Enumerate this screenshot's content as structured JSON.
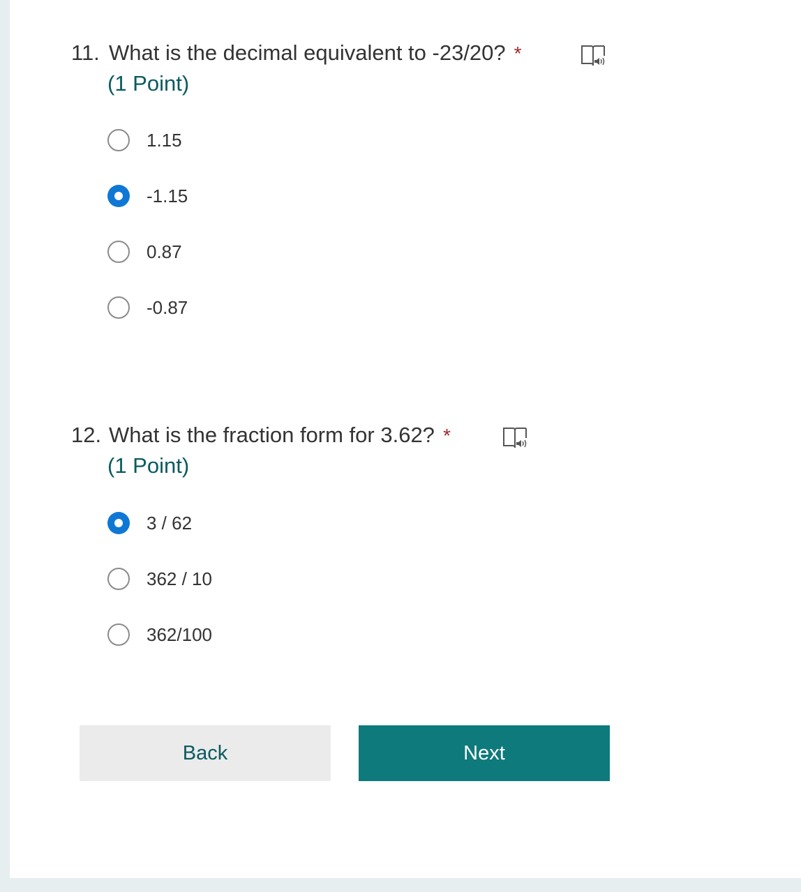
{
  "questions": [
    {
      "number": "11.",
      "text": "What is the decimal equivalent to -23/20?",
      "required_mark": "*",
      "points": "(1 Point)",
      "reader_icon": "immersive-reader-icon",
      "options": [
        {
          "label": "1.15",
          "selected": false
        },
        {
          "label": "-1.15",
          "selected": true
        },
        {
          "label": "0.87",
          "selected": false
        },
        {
          "label": "-0.87",
          "selected": false
        }
      ]
    },
    {
      "number": "12.",
      "text": "What is the fraction form for 3.62?",
      "required_mark": "*",
      "points": "(1 Point)",
      "reader_icon": "immersive-reader-icon",
      "options": [
        {
          "label": "3 / 62",
          "selected": true
        },
        {
          "label": "362 / 10",
          "selected": false
        },
        {
          "label": "362/100",
          "selected": false
        }
      ]
    }
  ],
  "buttons": {
    "back": "Back",
    "next": "Next"
  },
  "colors": {
    "accent": "#0e7a7c",
    "radio_selected": "#0f78d4",
    "required": "#a4262c",
    "points": "#0b5a5e"
  }
}
